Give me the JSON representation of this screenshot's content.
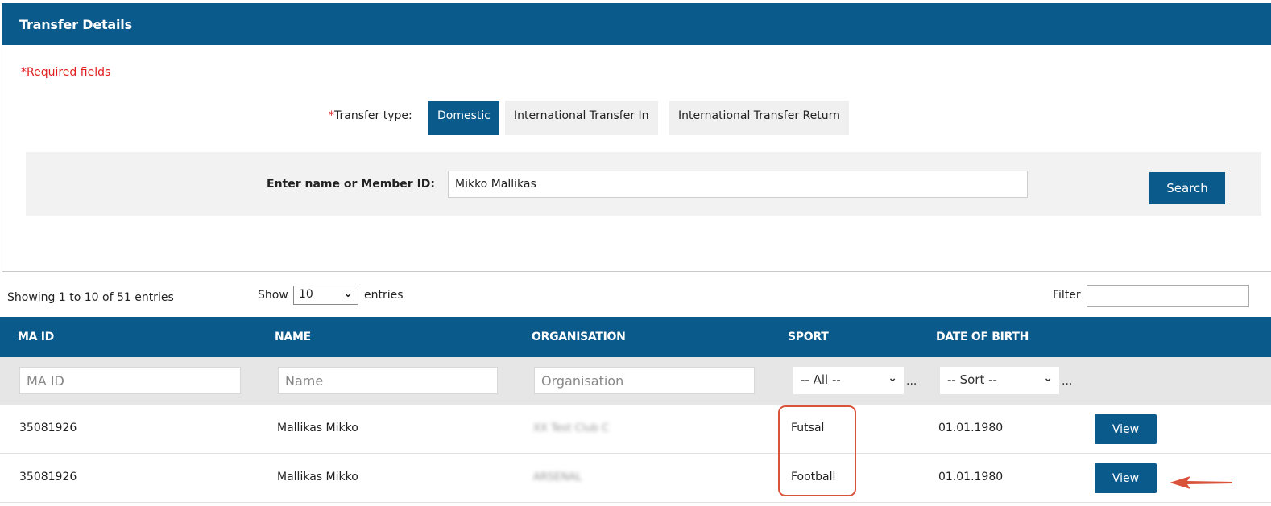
{
  "panel": {
    "title": "Transfer Details",
    "required_note": "*Required fields"
  },
  "transfer_type": {
    "star": "*",
    "label": "Transfer type:",
    "options": [
      "Domestic",
      "International Transfer In",
      "International Transfer Return"
    ],
    "selected": "Domestic"
  },
  "search": {
    "label": "Enter name or Member ID:",
    "value": "Mikko Mallikas",
    "button": "Search"
  },
  "listing": {
    "showing": "Showing 1 to 10 of 51 entries",
    "show_label": "Show",
    "page_size": "10",
    "entries_label": "entries",
    "filter_label": "Filter"
  },
  "table": {
    "columns": [
      "MA ID",
      "NAME",
      "ORGANISATION",
      "SPORT",
      "DATE OF BIRTH"
    ],
    "filters": {
      "ma_id_placeholder": "MA ID",
      "name_placeholder": "Name",
      "organisation_placeholder": "Organisation",
      "sport_selected": "-- All --",
      "dob_selected": "-- Sort --",
      "ellipsis": "..."
    },
    "rows": [
      {
        "ma_id": "35081926",
        "name": "Mallikas Mikko",
        "organisation": "XX Test Club C",
        "sport": "Futsal",
        "dob": "01.01.1980",
        "action": "View"
      },
      {
        "ma_id": "35081926",
        "name": "Mallikas Mikko",
        "organisation": "ARSENAL",
        "sport": "Football",
        "dob": "01.01.1980",
        "action": "View"
      }
    ]
  },
  "colors": {
    "primary": "#0b5a8c",
    "required": "#e02020",
    "annotation": "#d9533b"
  },
  "icons": [
    "chevron-down-icon",
    "arrow-left-icon"
  ]
}
